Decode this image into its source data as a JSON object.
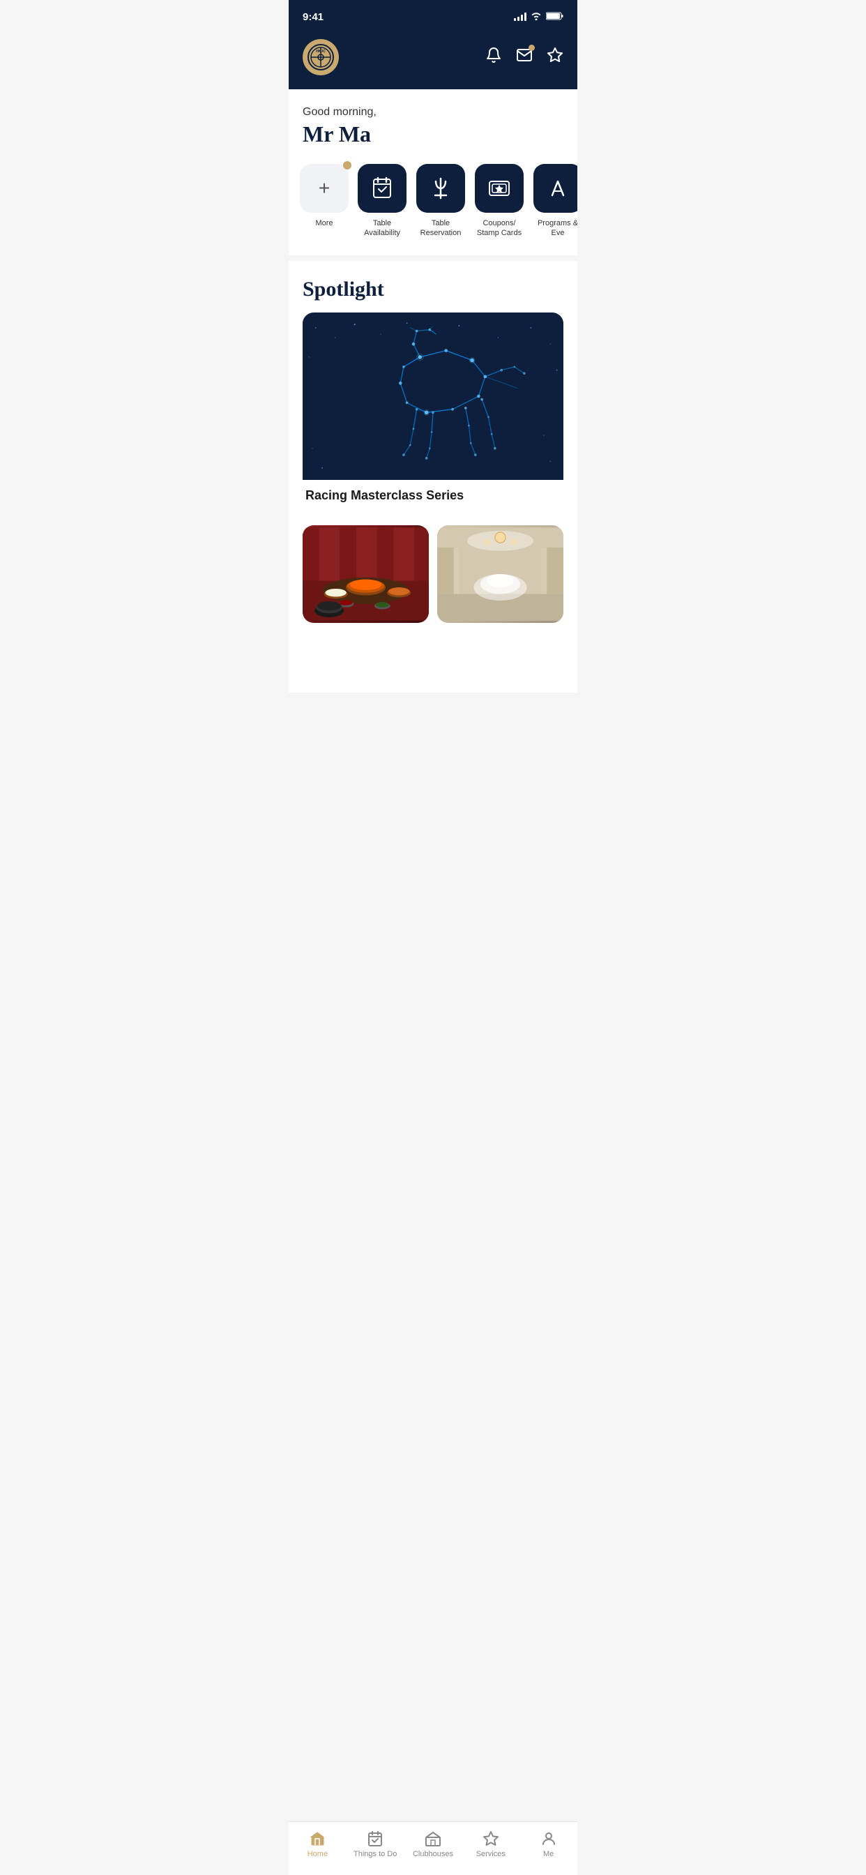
{
  "statusBar": {
    "time": "9:41"
  },
  "header": {
    "logoAlt": "Club Logo"
  },
  "greeting": {
    "sub": "Good morning,",
    "name": "Mr Ma"
  },
  "quickActions": [
    {
      "id": "more",
      "label": "More",
      "type": "light",
      "icon": "+",
      "hasDot": true
    },
    {
      "id": "table-availability",
      "label": "Table Availability",
      "type": "dark",
      "icon": "check-calendar",
      "hasDot": false
    },
    {
      "id": "table-reservation",
      "label": "Table Reservation",
      "type": "dark",
      "icon": "fork-knife",
      "hasDot": false
    },
    {
      "id": "coupons",
      "label": "Coupons/ Stamp Cards",
      "type": "dark",
      "icon": "stamp-card",
      "hasDot": false
    },
    {
      "id": "programs",
      "label": "Programs & Eve",
      "type": "dark",
      "icon": "party",
      "hasDot": false
    }
  ],
  "spotlight": {
    "title": "Spotlight",
    "card": {
      "title": "Racing Masterclass Series"
    }
  },
  "bottomNav": [
    {
      "id": "home",
      "label": "Home",
      "icon": "🏠",
      "active": true
    },
    {
      "id": "things-to-do",
      "label": "Things to Do",
      "icon": "📅",
      "active": false
    },
    {
      "id": "clubhouses",
      "label": "Clubhouses",
      "icon": "🏛",
      "active": false
    },
    {
      "id": "services",
      "label": "Services",
      "icon": "💎",
      "active": false
    },
    {
      "id": "me",
      "label": "Me",
      "icon": "👤",
      "active": false
    }
  ]
}
